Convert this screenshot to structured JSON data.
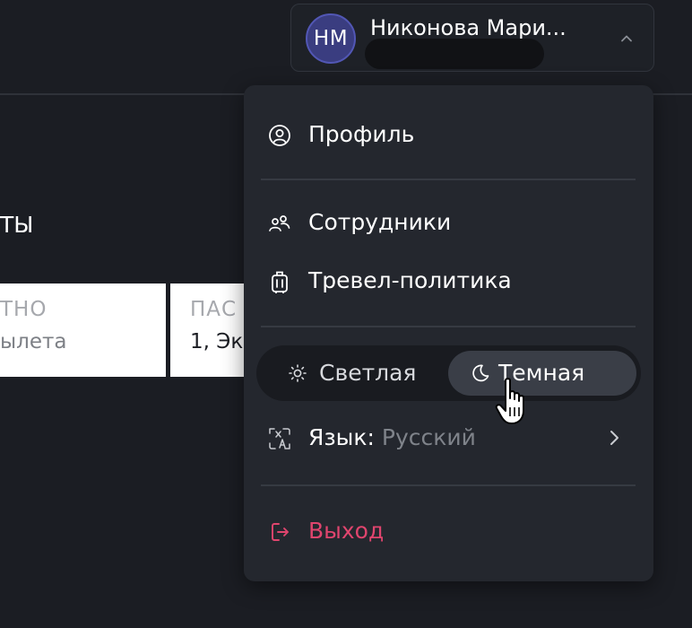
{
  "header": {
    "user": {
      "initials": "НМ",
      "name": "Никонова Мари..."
    }
  },
  "background": {
    "title_fragment": "ТЫ",
    "cards": [
      {
        "label": "ТНО",
        "value": "ылета"
      },
      {
        "label": "ПАС",
        "value": "1, Эк"
      }
    ]
  },
  "menu": {
    "profile": {
      "label": "Профиль",
      "icon": "user-circle-icon"
    },
    "employees": {
      "label": "Сотрудники",
      "icon": "users-icon"
    },
    "travel_policy": {
      "label": "Тревел-политика",
      "icon": "suitcase-icon"
    },
    "theme": {
      "light_label": "Светлая",
      "dark_label": "Темная",
      "selected": "dark"
    },
    "language": {
      "label": "Язык:",
      "value": "Русский",
      "icon": "translate-icon"
    },
    "logout": {
      "label": "Выход",
      "icon": "logout-icon"
    }
  },
  "colors": {
    "background": "#1b1d23",
    "menu_bg": "#24272e",
    "avatar_bg": "#3a3d80",
    "logout": "#e0456e",
    "muted_text": "#7f838a",
    "toggle_active": "#3a3e47"
  }
}
